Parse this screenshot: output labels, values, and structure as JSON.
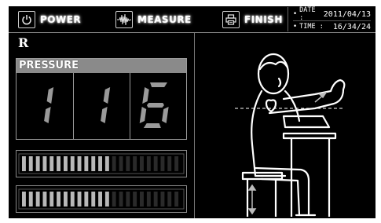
{
  "header": {
    "power": {
      "label": "POWER",
      "icon": "power-icon"
    },
    "measure": {
      "label": "MEASURE",
      "icon": "waveform-icon"
    },
    "finish": {
      "label": "FINISH",
      "icon": "printer-icon"
    },
    "date": {
      "bullet": "•",
      "label": "DATE :",
      "value": "2011/04/13"
    },
    "time": {
      "bullet": "•",
      "label": "TIME :",
      "value": "16/34/24"
    }
  },
  "measurement": {
    "side": "R",
    "title": "PRESSURE",
    "digits": [
      "1",
      "1",
      "6"
    ]
  },
  "level_bars": [
    {
      "filled_segments": 13,
      "total_segments": 23
    },
    {
      "filled_segments": 13,
      "total_segments": 23
    }
  ],
  "colors": {
    "screen_bg": "#000000",
    "segment_fill": "#9a9a9a",
    "bar_fill": "#b8b8b8",
    "bar_empty": "#2a2a2a",
    "figure_line": "#ffffff"
  }
}
